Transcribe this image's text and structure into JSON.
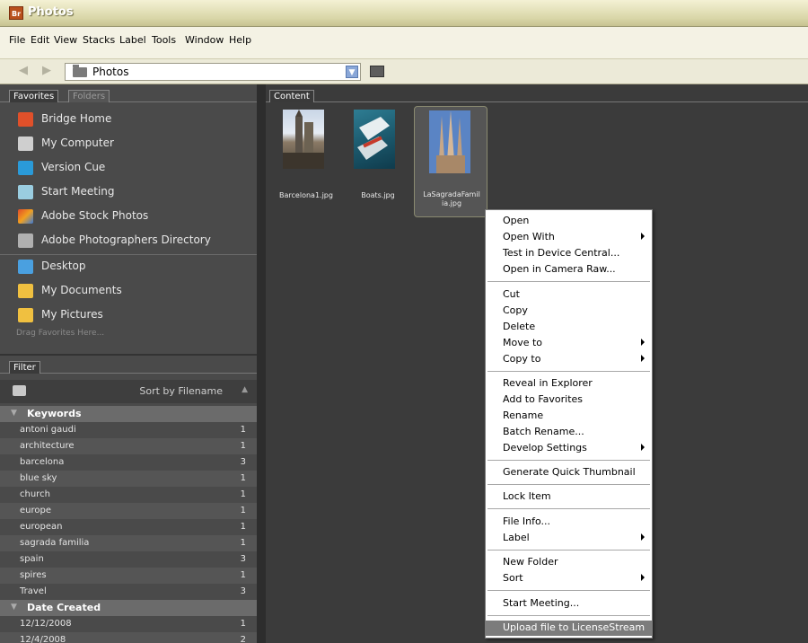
{
  "window": {
    "app_badge": "Br",
    "title": "Photos"
  },
  "menubar": [
    "File",
    "Edit",
    "View",
    "Stacks",
    "Label",
    "Tools",
    "Window",
    "Help"
  ],
  "pathbar": {
    "path": "Photos"
  },
  "left_tabs": {
    "favorites": "Favorites",
    "folders": "Folders"
  },
  "favorites": [
    {
      "label": "Bridge Home",
      "icon": "bridge-home-icon",
      "color": "#e0502a"
    },
    {
      "label": "My Computer",
      "icon": "computer-icon",
      "color": "#cfcfcf"
    },
    {
      "label": "Version Cue",
      "icon": "version-cue-icon",
      "color": "#2a9ad8"
    },
    {
      "label": "Start Meeting",
      "icon": "meeting-icon",
      "color": "#9acde0"
    },
    {
      "label": "Adobe Stock Photos",
      "icon": "stock-photos-icon",
      "color": "#e07030"
    },
    {
      "label": "Adobe Photographers Directory",
      "icon": "photographers-icon",
      "color": "#b0b0b0"
    },
    {
      "label": "Desktop",
      "icon": "desktop-icon",
      "color": "#4aa0e0"
    },
    {
      "label": "My Documents",
      "icon": "folder-icon",
      "color": "#f0c040"
    },
    {
      "label": "My Pictures",
      "icon": "pictures-folder-icon",
      "color": "#f0c040"
    }
  ],
  "drag_hint": "Drag Favorites Here...",
  "filter": {
    "tab": "Filter",
    "sort_label": "Sort by Filename",
    "keywords_header": "Keywords",
    "keywords": [
      {
        "name": "antoni gaudi",
        "count": "1"
      },
      {
        "name": "architecture",
        "count": "1"
      },
      {
        "name": "barcelona",
        "count": "3"
      },
      {
        "name": "blue sky",
        "count": "1"
      },
      {
        "name": "church",
        "count": "1"
      },
      {
        "name": "europe",
        "count": "1"
      },
      {
        "name": "european",
        "count": "1"
      },
      {
        "name": "sagrada familia",
        "count": "1"
      },
      {
        "name": "spain",
        "count": "3"
      },
      {
        "name": "spires",
        "count": "1"
      },
      {
        "name": "Travel",
        "count": "3"
      }
    ],
    "date_header": "Date Created",
    "dates": [
      {
        "name": "12/12/2008",
        "count": "1"
      },
      {
        "name": "12/4/2008",
        "count": "2"
      }
    ]
  },
  "content": {
    "tab": "Content",
    "thumbnails": [
      {
        "name": "Barcelona1.jpg",
        "selected": false
      },
      {
        "name": "Boats.jpg",
        "selected": false
      },
      {
        "name_line1": "LaSagradaFamil",
        "name_line2": "ia.jpg",
        "selected": true
      }
    ]
  },
  "context_menu": {
    "items": [
      {
        "label": "Open"
      },
      {
        "label": "Open With",
        "submenu": true
      },
      {
        "label": "Test in Device Central..."
      },
      {
        "label": "Open in Camera Raw..."
      },
      {
        "sep": true
      },
      {
        "label": "Cut"
      },
      {
        "label": "Copy"
      },
      {
        "label": "Delete"
      },
      {
        "label": "Move to",
        "submenu": true
      },
      {
        "label": "Copy to",
        "submenu": true
      },
      {
        "sep": true
      },
      {
        "label": "Reveal in Explorer"
      },
      {
        "label": "Add to Favorites"
      },
      {
        "label": "Rename"
      },
      {
        "label": "Batch Rename..."
      },
      {
        "label": "Develop Settings",
        "submenu": true
      },
      {
        "sep": true
      },
      {
        "label": "Generate Quick Thumbnail"
      },
      {
        "sep": true
      },
      {
        "label": "Lock Item"
      },
      {
        "sep": true
      },
      {
        "label": "File Info..."
      },
      {
        "label": "Label",
        "submenu": true
      },
      {
        "sep": true
      },
      {
        "label": "New Folder"
      },
      {
        "label": "Sort",
        "submenu": true
      },
      {
        "sep": true
      },
      {
        "label": "Start Meeting..."
      },
      {
        "sep": true
      },
      {
        "label": "Upload file to LicenseStream",
        "highlighted": true
      }
    ]
  }
}
